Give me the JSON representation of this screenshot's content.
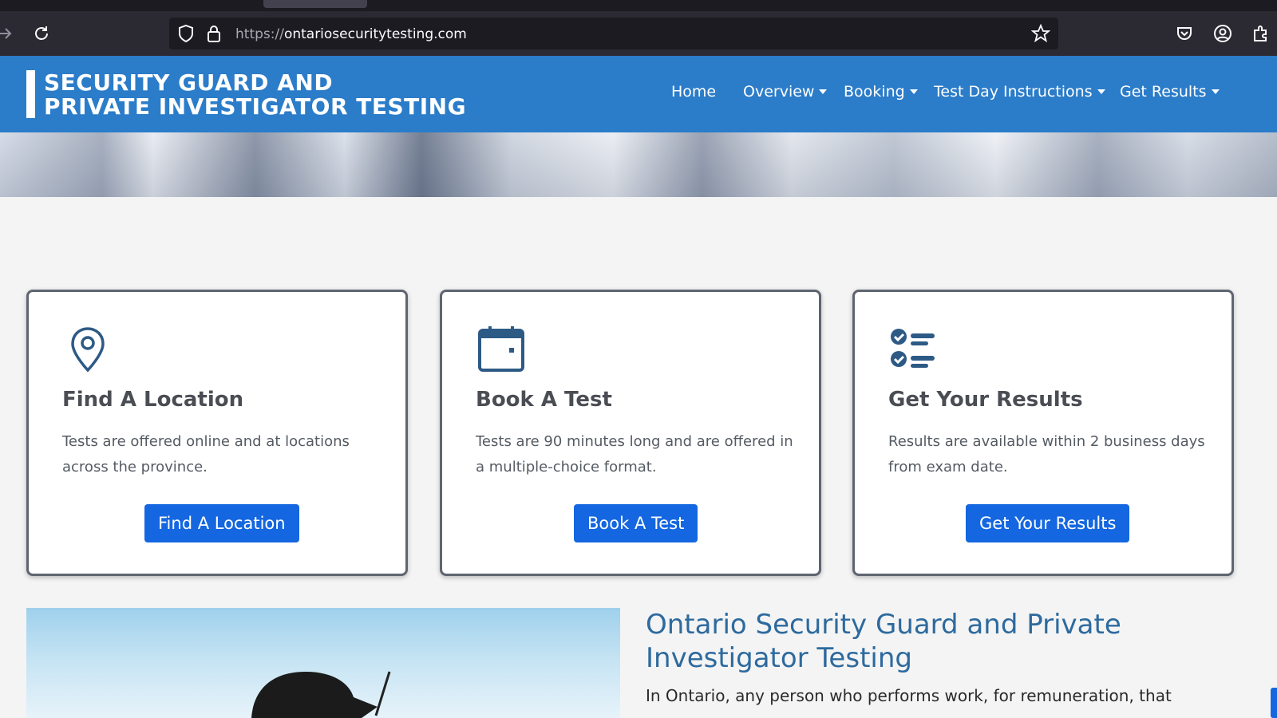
{
  "browser": {
    "url_scheme": "https://",
    "url_host": "ontariosecuritytesting.com"
  },
  "site": {
    "logo_line1": "SECURITY GUARD AND",
    "logo_line2": "PRIVATE INVESTIGATOR TESTING",
    "nav": [
      {
        "label": "Home",
        "has_dropdown": false
      },
      {
        "label": "Overview",
        "has_dropdown": true
      },
      {
        "label": "Booking",
        "has_dropdown": true
      },
      {
        "label": "Test Day Instructions",
        "has_dropdown": true
      },
      {
        "label": "Get Results",
        "has_dropdown": true
      }
    ]
  },
  "cards": [
    {
      "icon": "map-pin-icon",
      "title": "Find A Location",
      "text": "Tests are offered online and at locations across the province.",
      "button": "Find A Location"
    },
    {
      "icon": "calendar-icon",
      "title": "Book A Test",
      "text": "Tests are 90 minutes long and are offered in a multiple-choice format.",
      "button": "Book A Test"
    },
    {
      "icon": "checklist-icon",
      "title": "Get Your Results",
      "text": "Results are available within 2 business days from exam date.",
      "button": "Get Your Results"
    }
  ],
  "section": {
    "title": "Ontario Security Guard and Private Investigator Testing",
    "text": "In Ontario, any person who performs work, for remuneration, that"
  },
  "colors": {
    "header": "#2b7cc9",
    "button": "#1467e0",
    "icon": "#2d5a85"
  }
}
